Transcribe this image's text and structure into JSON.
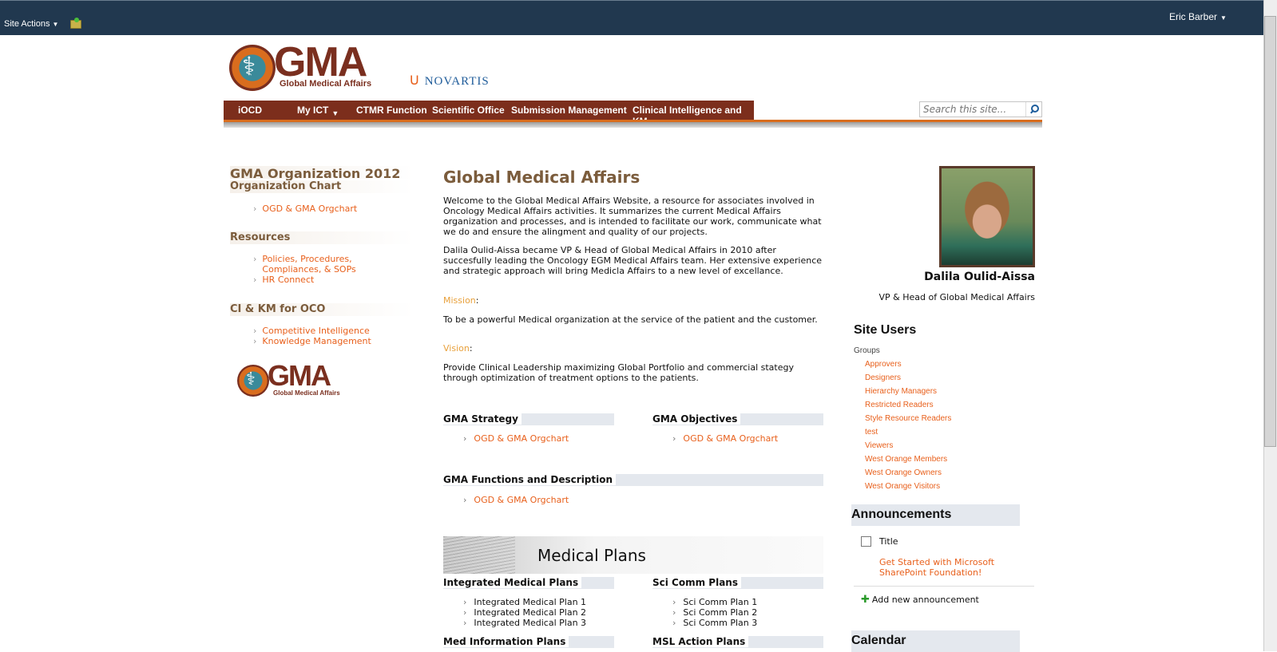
{
  "topbar": {
    "site_actions": "Site Actions",
    "user": "Eric Barber"
  },
  "brand": {
    "logo_text": "GMA",
    "logo_sub": "Global Medical Affairs",
    "partner": "NOVARTIS"
  },
  "nav": {
    "items": [
      "iOCD",
      "My ICT",
      "CTMR Function",
      "Scientific Office",
      "Submission Management",
      "Clinical Intelligence and KM"
    ]
  },
  "search": {
    "placeholder": "Search this site..."
  },
  "left": {
    "org_title": "GMA Organization 2012",
    "org_sub": "Organization Chart",
    "org_link": "OGD & GMA Orgchart",
    "resources_title": "Resources",
    "resources_links": [
      "Policies, Procedures, Compliances, & SOPs",
      "HR Connect"
    ],
    "ci_title": "CI & KM for OCO",
    "ci_links": [
      "Competitive Intelligence",
      "Knowledge Management"
    ]
  },
  "main": {
    "title": "Global Medical Affairs",
    "intro": "Welcome to the Global Medical Affairs Website, a resource for associates involved in Oncology Medical Affairs activities. It summarizes the current Medical Affairs organization and processes, and is intended to facilitate our work, communicate what we do and ensure the alingment and quality of our projects.",
    "bio": "Dalila Oulid-Aissa became VP & Head of Global Medical Affairs in 2010 after succesfully leading the Oncology EGM Medical Affairs team. Her extensive experience and strategic approach will bring Medicla Affairs to a new level of excellance.",
    "mission_label": "Mission",
    "mission": "To be a powerful Medical organization at the service of the patient and the customer.",
    "vision_label": "Vision",
    "vision": "Provide Clinical Leadership maximizing Global Portfolio and commercial stategy through optimization of treatment options to the patients.",
    "strategy_title": "GMA Strategy",
    "strategy_link": "OGD & GMA Orgchart",
    "objectives_title": "GMA Objectives",
    "objectives_link": "OGD & GMA Orgchart",
    "functions_title": "GMA Functions and Description",
    "functions_link": "OGD & GMA Orgchart",
    "banner_title": "Medical Plans",
    "imp_title": "Integrated Medical Plans",
    "imp_items": [
      "Integrated Medical Plan 1",
      "Integrated Medical Plan 2",
      "Integrated Medical Plan 3"
    ],
    "scicomm_title": "Sci Comm Plans",
    "scicomm_items": [
      "Sci Comm Plan 1",
      "Sci Comm Plan 2",
      "Sci Comm Plan 3"
    ],
    "medinfo_title": "Med Information Plans",
    "msl_title": "MSL Action Plans"
  },
  "right": {
    "person_name": "Dalila Oulid-Aissa",
    "person_role": "VP & Head of Global Medical Affairs",
    "site_users_title": "Site Users",
    "groups_label": "Groups",
    "groups": [
      "Approvers",
      "Designers",
      "Hierarchy Managers",
      "Restricted Readers",
      "Style Resource Readers",
      "test",
      "Viewers",
      "West Orange Members",
      "West Orange Owners",
      "West Orange Visitors"
    ],
    "announcements_title": "Announcements",
    "ann_column": "Title",
    "ann_item": "Get Started with Microsoft SharePoint Foundation!",
    "add_announcement": "Add new announcement",
    "calendar_title": "Calendar"
  }
}
